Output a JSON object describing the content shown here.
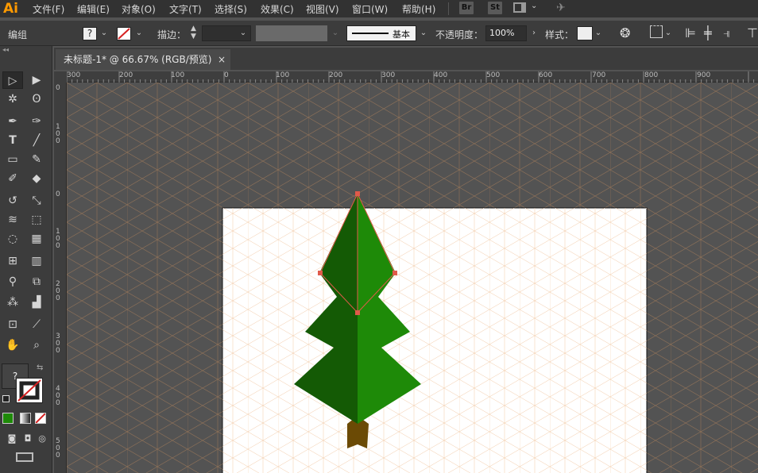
{
  "app": {
    "logo": "Ai"
  },
  "menu": [
    "文件(F)",
    "编辑(E)",
    "对象(O)",
    "文字(T)",
    "选择(S)",
    "效果(C)",
    "视图(V)",
    "窗口(W)",
    "帮助(H)"
  ],
  "top_icons": {
    "bridge": "Br",
    "stock": "St"
  },
  "control": {
    "mode_label": "编组",
    "fill_value": "?",
    "stroke_label": "描边：",
    "brush_label": "基本",
    "opacity_label": "不透明度：",
    "opacity_value": "100%",
    "style_label": "样式："
  },
  "document": {
    "tab_title": "未标题-1* @ 66.67% (RGB/预览)",
    "close": "×"
  },
  "rulers": {
    "top": [
      "300",
      "200",
      "100",
      "0",
      "100",
      "200",
      "300",
      "400",
      "500",
      "600",
      "700",
      "800",
      "900"
    ],
    "left": [
      "0",
      "100",
      "0",
      "100",
      "200",
      "300",
      "400",
      "500"
    ]
  },
  "toolbar": {
    "fill_value": "?"
  },
  "colors": {
    "tree_left": "#145a05",
    "tree_right": "#1e8a08",
    "trunk": "#6b4a05",
    "selection": "#e05a4a",
    "grid": "#e8a066"
  }
}
